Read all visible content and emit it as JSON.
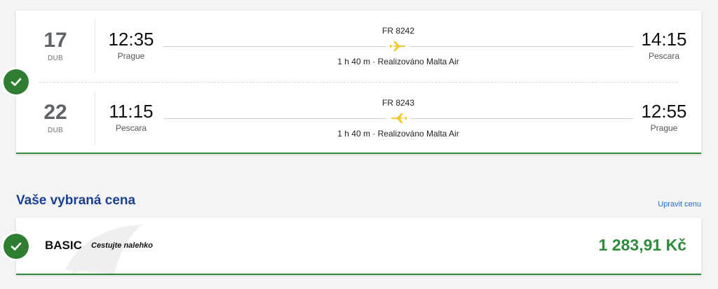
{
  "flights": [
    {
      "date_day": "17",
      "date_month": "DUB",
      "departure_time": "12:35",
      "departure_city": "Prague",
      "flight_number": "FR 8242",
      "duration_operator": "1 h 40 m · Realizováno Malta Air",
      "arrival_time": "14:15",
      "arrival_city": "Pescara"
    },
    {
      "date_day": "22",
      "date_month": "DUB",
      "departure_time": "11:15",
      "departure_city": "Pescara",
      "flight_number": "FR 8243",
      "duration_operator": "1 h 40 m · Realizováno Malta Air",
      "arrival_time": "12:55",
      "arrival_city": "Prague"
    }
  ],
  "price_section": {
    "title": "Vaše vybraná cena",
    "edit_link": "Upravit cenu",
    "fare_name": "BASIC",
    "fare_tagline": "Cestujte nalehko",
    "price": "1 283,91 Kč"
  },
  "colors": {
    "accent_green": "#2f8a3a",
    "title_blue": "#1b3f94",
    "link_blue": "#1f6ed4",
    "plane_yellow": "#f1c933"
  },
  "icons": {
    "selected": "checkmark-icon",
    "plane": "airplane-icon",
    "watermark": "harp-logo-watermark"
  }
}
